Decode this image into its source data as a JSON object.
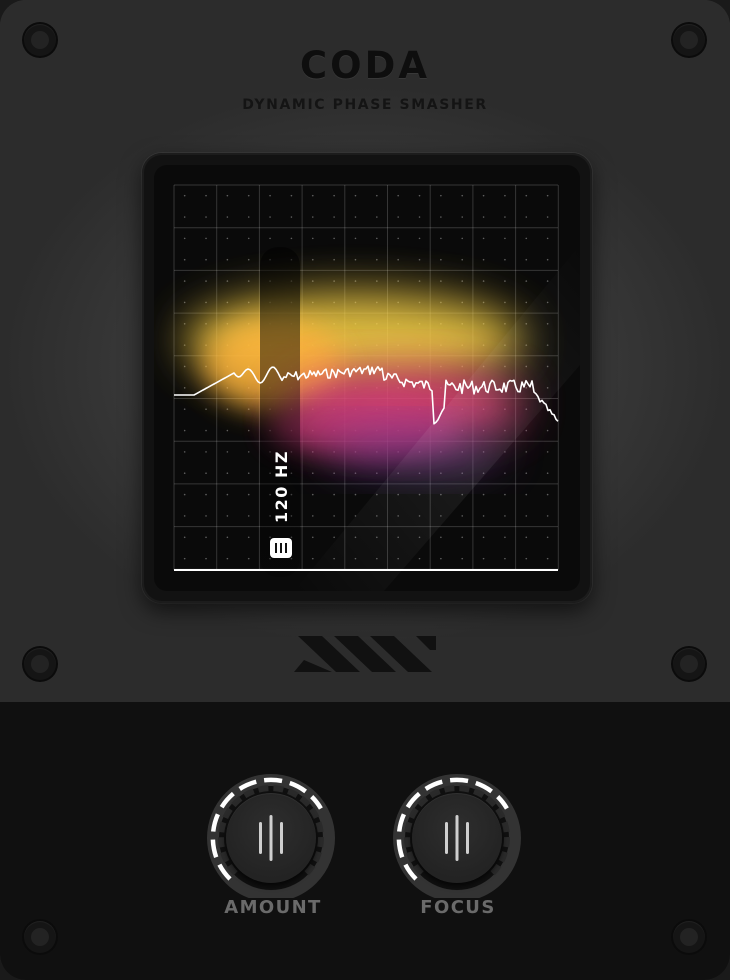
{
  "plugin": {
    "brand": "CODA",
    "subtitle": "DYNAMIC PHASE SMASHER"
  },
  "display": {
    "crossover_label": "120 HZ",
    "crossover_handle_icon": "grip-lines-icon",
    "spectrum_line_color": "#ffffff",
    "heat_colors": [
      "#ffe05a",
      "#ff8a3a",
      "#e0457a",
      "#6a3a9a"
    ]
  },
  "controls": {
    "knobs": [
      {
        "id": "amount",
        "label": "AMOUNT",
        "value": 0.72,
        "icon": "grip-lines-icon"
      },
      {
        "id": "focus",
        "label": "FOCUS",
        "value": 0.72,
        "icon": "grip-lines-icon"
      }
    ]
  },
  "logo": {
    "icon": "vent-stripes-logo-icon"
  }
}
